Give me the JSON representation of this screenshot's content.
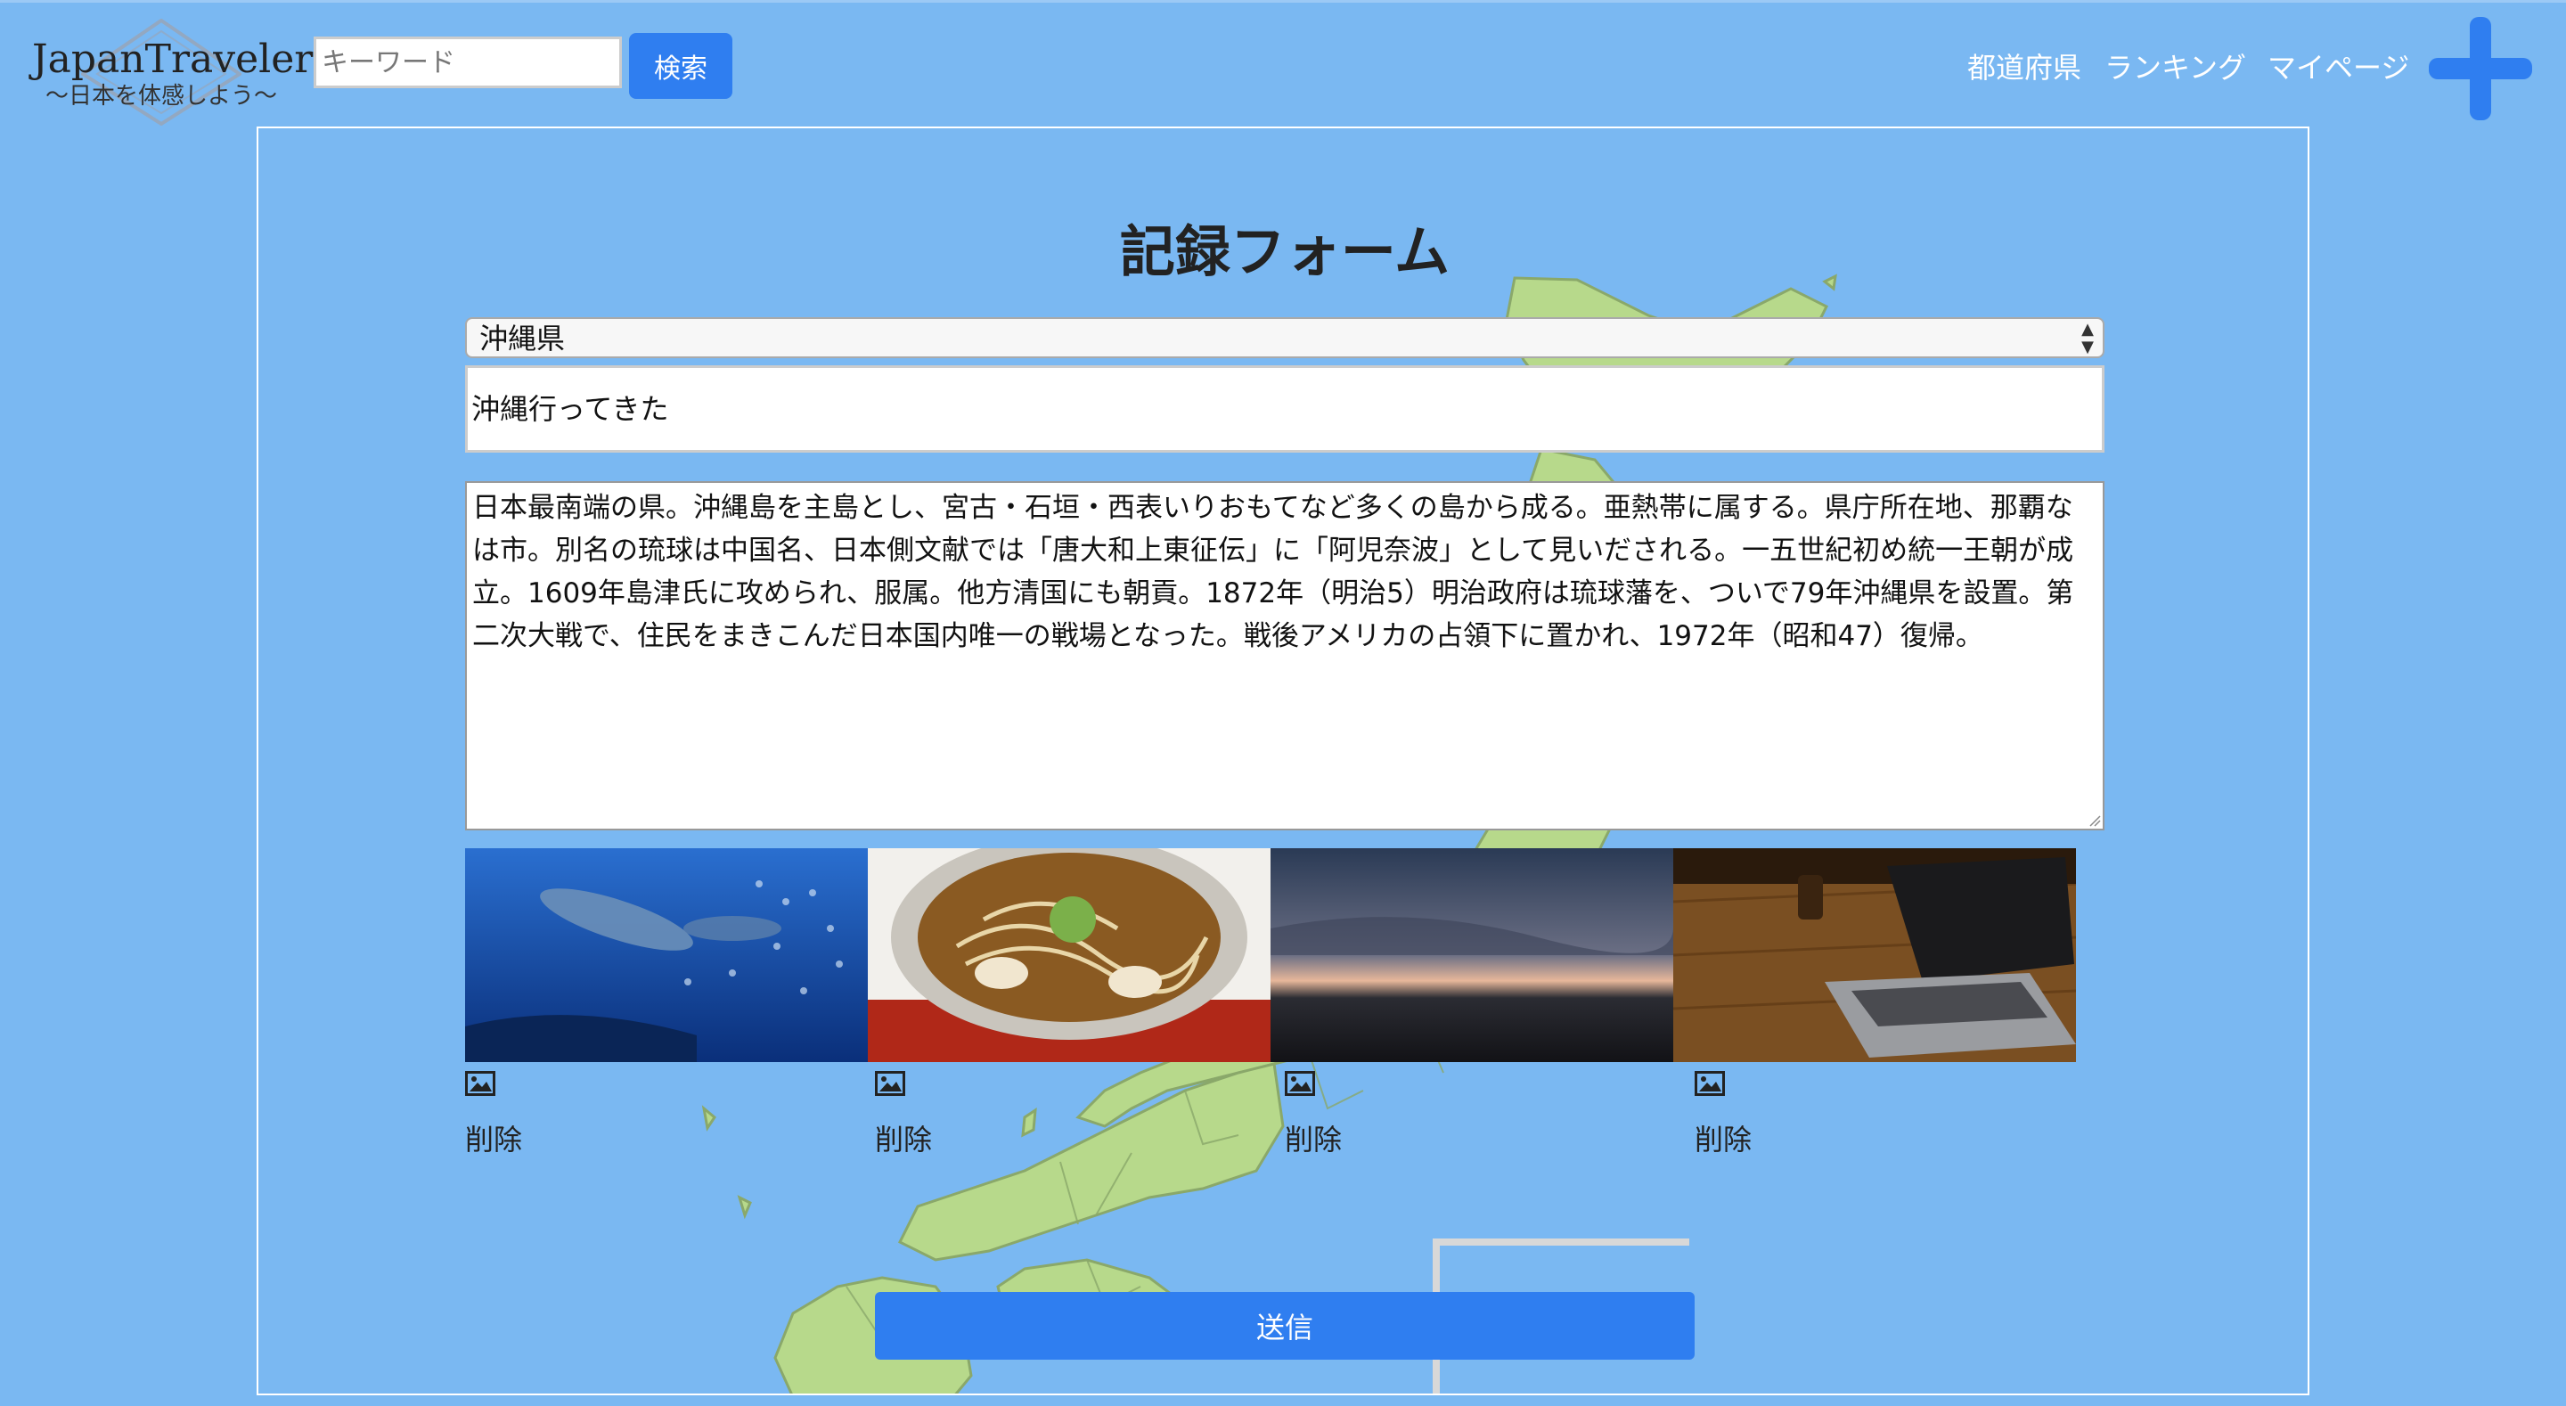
{
  "header": {
    "logo_title": "JapanTraveler",
    "logo_subtitle": "〜日本を体感しよう〜",
    "search_placeholder": "キーワード",
    "search_button": "検索",
    "nav": {
      "prefectures": "都道府県",
      "ranking": "ランキング",
      "mypage": "マイページ"
    },
    "add_icon": "plus-icon"
  },
  "form": {
    "title": "記録フォーム",
    "prefecture_selected": "沖縄県",
    "post_title_value": "沖縄行ってきた",
    "body_value": "日本最南端の県。沖縄島を主島とし、宮古・石垣・西表いりおもてなど多くの島から成る。亜熱帯に属する。県庁所在地、那覇なは市。別名の琉球は中国名、日本側文献では「唐大和上東征伝」に「阿児奈波」として見いだされる。一五世紀初め統一王朝が成立。1609年島津氏に攻められ、服属。他方清国にも朝貢。1872年（明治5）明治政府は琉球藩を、ついで79年沖縄県を設置。第二次大戦で、住民をまきこんだ日本国内唯一の戦場となった。戦後アメリカの占領下に置かれ、1972年（昭和47）復帰。",
    "photos": [
      {
        "subject": "whale shark aquarium",
        "icon": "image-icon",
        "delete_label": "削除"
      },
      {
        "subject": "okinawa soba noodles",
        "icon": "image-icon",
        "delete_label": "削除"
      },
      {
        "subject": "sunset over sea",
        "icon": "image-icon",
        "delete_label": "削除"
      },
      {
        "subject": "laptop on wooden table",
        "icon": "image-icon",
        "delete_label": "削除"
      }
    ],
    "submit_label": "送信"
  },
  "colors": {
    "background": "#7ab8f2",
    "accent": "#2f7ef0",
    "map_land": "#b7d98b"
  }
}
